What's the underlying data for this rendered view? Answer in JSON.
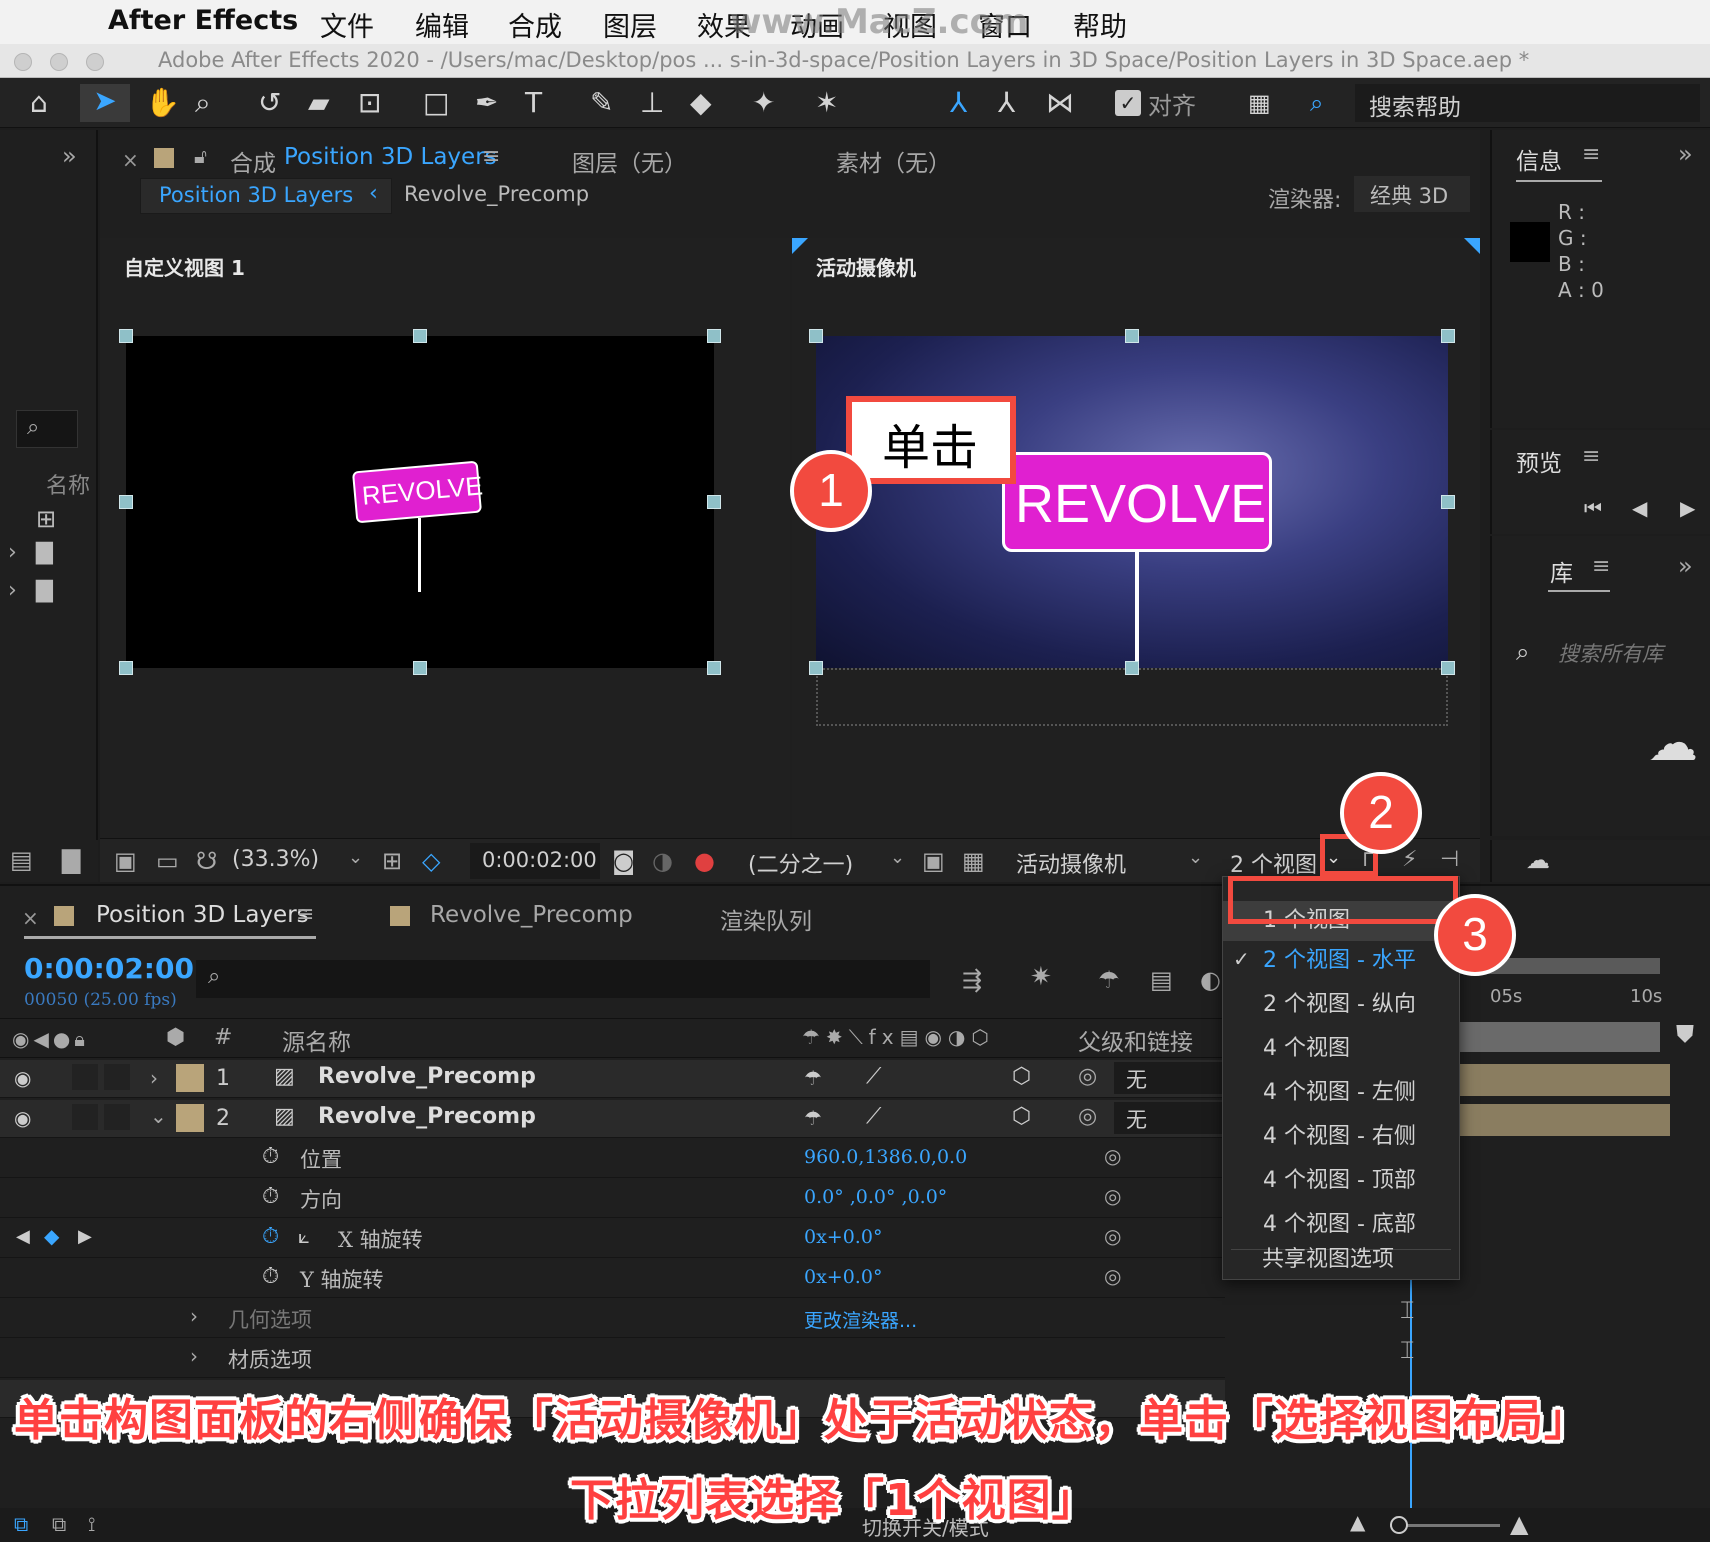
{
  "menubar": {
    "app": "After Effects",
    "items": [
      "文件",
      "编辑",
      "合成",
      "图层",
      "效果",
      "动画",
      "视图",
      "窗口",
      "帮助"
    ],
    "watermark": "www.MacZ.com"
  },
  "window": {
    "title": "Adobe After Effects 2020 - /Users/mac/Desktop/pos ... s-in-3d-space/Position Layers in 3D Space/Position Layers in 3D Space.aep *"
  },
  "toolbar": {
    "snap_label": "对齐",
    "search_help": "搜索帮助"
  },
  "comp_panel": {
    "tab_prefix": "合成",
    "tab_name": "Position 3D Layers",
    "layer_tab": "图层（无）",
    "footage_tab": "素材（无）",
    "breadcrumb_active": "Position 3D Layers",
    "breadcrumb_next": "Revolve_Precomp",
    "renderer_label": "渲染器:",
    "renderer_value": "经典 3D",
    "left_view_label": "自定义视图 1",
    "right_view_label": "活动摄像机",
    "sign_text": "REVOLVE",
    "zoom": "(33.3%)",
    "timecode": "0:00:02:00",
    "resolution": "(二分之一)",
    "camera": "活动摄像机",
    "views": "2 个视图"
  },
  "project_panel": {
    "name_label": "名称"
  },
  "info_panel": {
    "title": "信息",
    "r": "R :",
    "g": "G :",
    "b": "B :",
    "a": "A :  0"
  },
  "preview_panel": {
    "title": "预览"
  },
  "library_panel": {
    "title": "库",
    "search_placeholder": "搜索所有库"
  },
  "timeline": {
    "tab_active": "Position 3D Layers",
    "tab2": "Revolve_Precomp",
    "tab3": "渲染队列",
    "timecode": "0:00:02:00",
    "frames": "00050 (25.00 fps)",
    "col_hash": "#",
    "col_source": "源名称",
    "col_parent": "父级和链接",
    "ruler_05": "05s",
    "ruler_10": "10s",
    "footer_toggle": "切换开关/模式",
    "layers": [
      {
        "num": "1",
        "name": "Revolve_Precomp",
        "parent": "无"
      },
      {
        "num": "2",
        "name": "Revolve_Precomp",
        "parent": "无"
      }
    ],
    "props": [
      {
        "name": "位置",
        "value": "960.0,1386.0,0.0"
      },
      {
        "name": "方向",
        "value": "0.0°  ,0.0°  ,0.0°"
      },
      {
        "name": "X 轴旋转",
        "value": "0x+0.0°"
      },
      {
        "name": "Y 轴旋转",
        "value": "0x+0.0°"
      }
    ],
    "geometry": "几何选项",
    "geometry_value": "更改渲染器...",
    "material": "材质选项"
  },
  "view_menu": {
    "items": [
      "1 个视图",
      "2 个视图 - 水平",
      "2 个视图 - 纵向",
      "4 个视图",
      "4 个视图 - 左侧",
      "4 个视图 - 右侧",
      "4 个视图 - 顶部",
      "4 个视图 - 底部"
    ],
    "checked_index": 1,
    "share": "共享视图选项"
  },
  "annotations": {
    "click_label": "单击",
    "step1": "1",
    "step2": "2",
    "step3": "3",
    "caption_line1": "单击构图面板的右侧确保「活动摄像机」处于活动状态，单击「选择视图布局」",
    "caption_line2": "下拉列表选择「1个视图」"
  },
  "colors": {
    "accent": "#3aa6ff",
    "annotation_red": "#f24a3f",
    "sign_magenta": "#e020d0"
  }
}
